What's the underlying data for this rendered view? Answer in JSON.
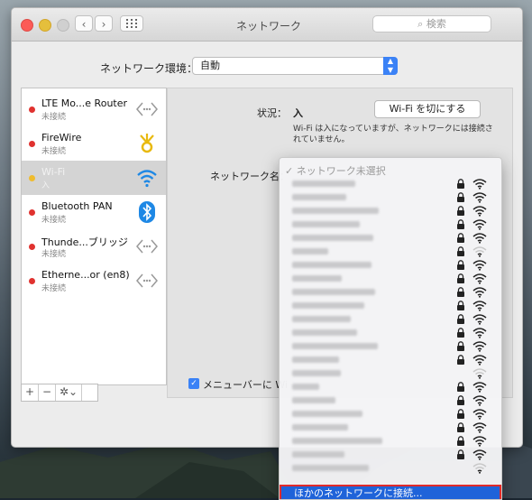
{
  "window": {
    "title": "ネットワーク",
    "search_placeholder": "検索",
    "nav_back": "‹",
    "nav_forward": "›"
  },
  "location": {
    "label": "ネットワーク環境：",
    "value": "自動"
  },
  "sidebar": {
    "items": [
      {
        "name": "LTE Mo...e Router",
        "status": "未接続",
        "icon": "phone-hotspot-icon"
      },
      {
        "name": "FireWire",
        "status": "未接続",
        "icon": "firewire-icon"
      },
      {
        "name": "Wi-Fi",
        "status": "入",
        "icon": "wifi-icon",
        "selected": true
      },
      {
        "name": "Bluetooth PAN",
        "status": "未接続",
        "icon": "bluetooth-icon"
      },
      {
        "name": "Thunde...ブリッジ",
        "status": "未接続",
        "icon": "thunderbolt-bridge-icon"
      },
      {
        "name": "Etherne...or (en8)",
        "status": "未接続",
        "icon": "ethernet-icon"
      }
    ],
    "add_label": "+",
    "remove_label": "−",
    "gear_label": "✲⌄"
  },
  "detail": {
    "status_label": "状況：",
    "status_value": "入",
    "wifi_off_button": "Wi-Fi を切にする",
    "status_description": "Wi-Fi は入になっていますが、ネットワークには接続されていません。",
    "network_name_label": "ネットワーク名：",
    "show_in_menubar_label": "メニューバーに Wi"
  },
  "network_menu": {
    "selected_item": "✓ ネットワーク未選択",
    "networks": [
      {
        "lock": true,
        "signal": 3
      },
      {
        "lock": true,
        "signal": 3
      },
      {
        "lock": true,
        "signal": 3
      },
      {
        "lock": true,
        "signal": 3
      },
      {
        "lock": true,
        "signal": 3
      },
      {
        "lock": true,
        "signal": 1
      },
      {
        "lock": true,
        "signal": 3
      },
      {
        "lock": true,
        "signal": 3
      },
      {
        "lock": true,
        "signal": 3
      },
      {
        "lock": true,
        "signal": 3
      },
      {
        "lock": true,
        "signal": 3
      },
      {
        "lock": true,
        "signal": 3
      },
      {
        "lock": true,
        "signal": 3
      },
      {
        "lock": true,
        "signal": 3
      },
      {
        "lock": false,
        "signal": 1
      },
      {
        "lock": true,
        "signal": 3
      },
      {
        "lock": true,
        "signal": 3
      },
      {
        "lock": true,
        "signal": 3
      },
      {
        "lock": true,
        "signal": 3
      },
      {
        "lock": true,
        "signal": 3
      },
      {
        "lock": true,
        "signal": 3
      },
      {
        "lock": false,
        "signal": 1
      }
    ],
    "other_network": "ほかのネットワークに接続..."
  },
  "colors": {
    "accent": "#3b82f6",
    "highlight": "#1f63d9",
    "status_red": "#e0322f",
    "status_yellow": "#efbc2e"
  }
}
